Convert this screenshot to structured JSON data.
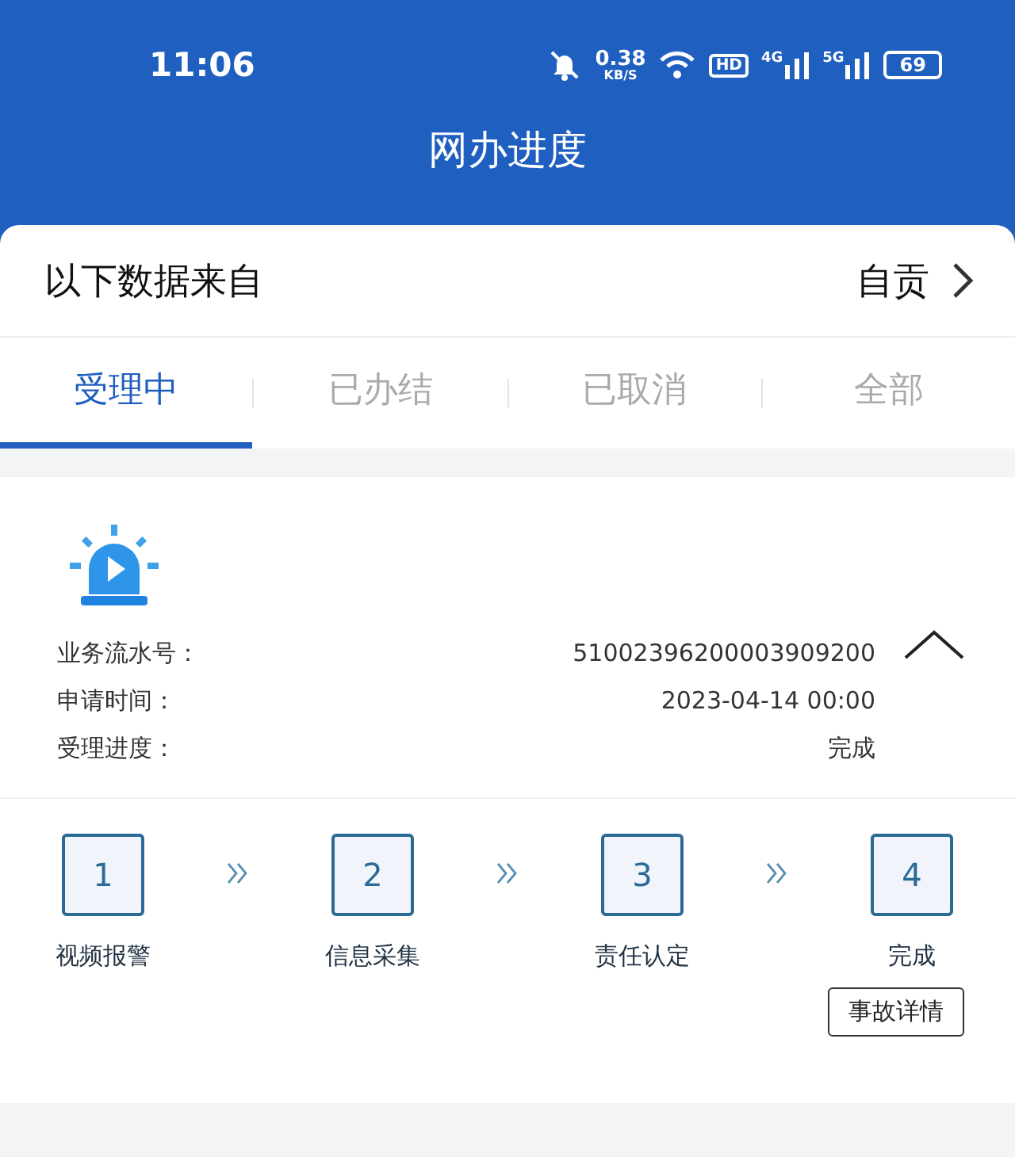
{
  "status_bar": {
    "time": "11:06",
    "speed": "0.38",
    "speed_unit": "KB/S",
    "hd": "HD",
    "networks": [
      "4G",
      "5G"
    ],
    "battery": "69"
  },
  "header": {
    "title": "网办进度"
  },
  "source": {
    "label": "以下数据来自",
    "value": "自贡"
  },
  "tabs": [
    {
      "label": "受理中",
      "selected": true
    },
    {
      "label": "已办结",
      "selected": false
    },
    {
      "label": "已取消",
      "selected": false
    },
    {
      "label": "全部",
      "selected": false
    }
  ],
  "record": {
    "expanded": true,
    "fields": [
      {
        "label": "业务流水号：",
        "value": "51002396200003909200"
      },
      {
        "label": "申请时间：",
        "value": "2023-04-14 00:00"
      },
      {
        "label": "受理进度：",
        "value": "完成"
      }
    ],
    "steps": [
      {
        "number": "1",
        "label": "视频报警"
      },
      {
        "number": "2",
        "label": "信息采集"
      },
      {
        "number": "3",
        "label": "责任认定"
      },
      {
        "number": "4",
        "label": "完成"
      }
    ],
    "detail_button": "事故详情"
  }
}
